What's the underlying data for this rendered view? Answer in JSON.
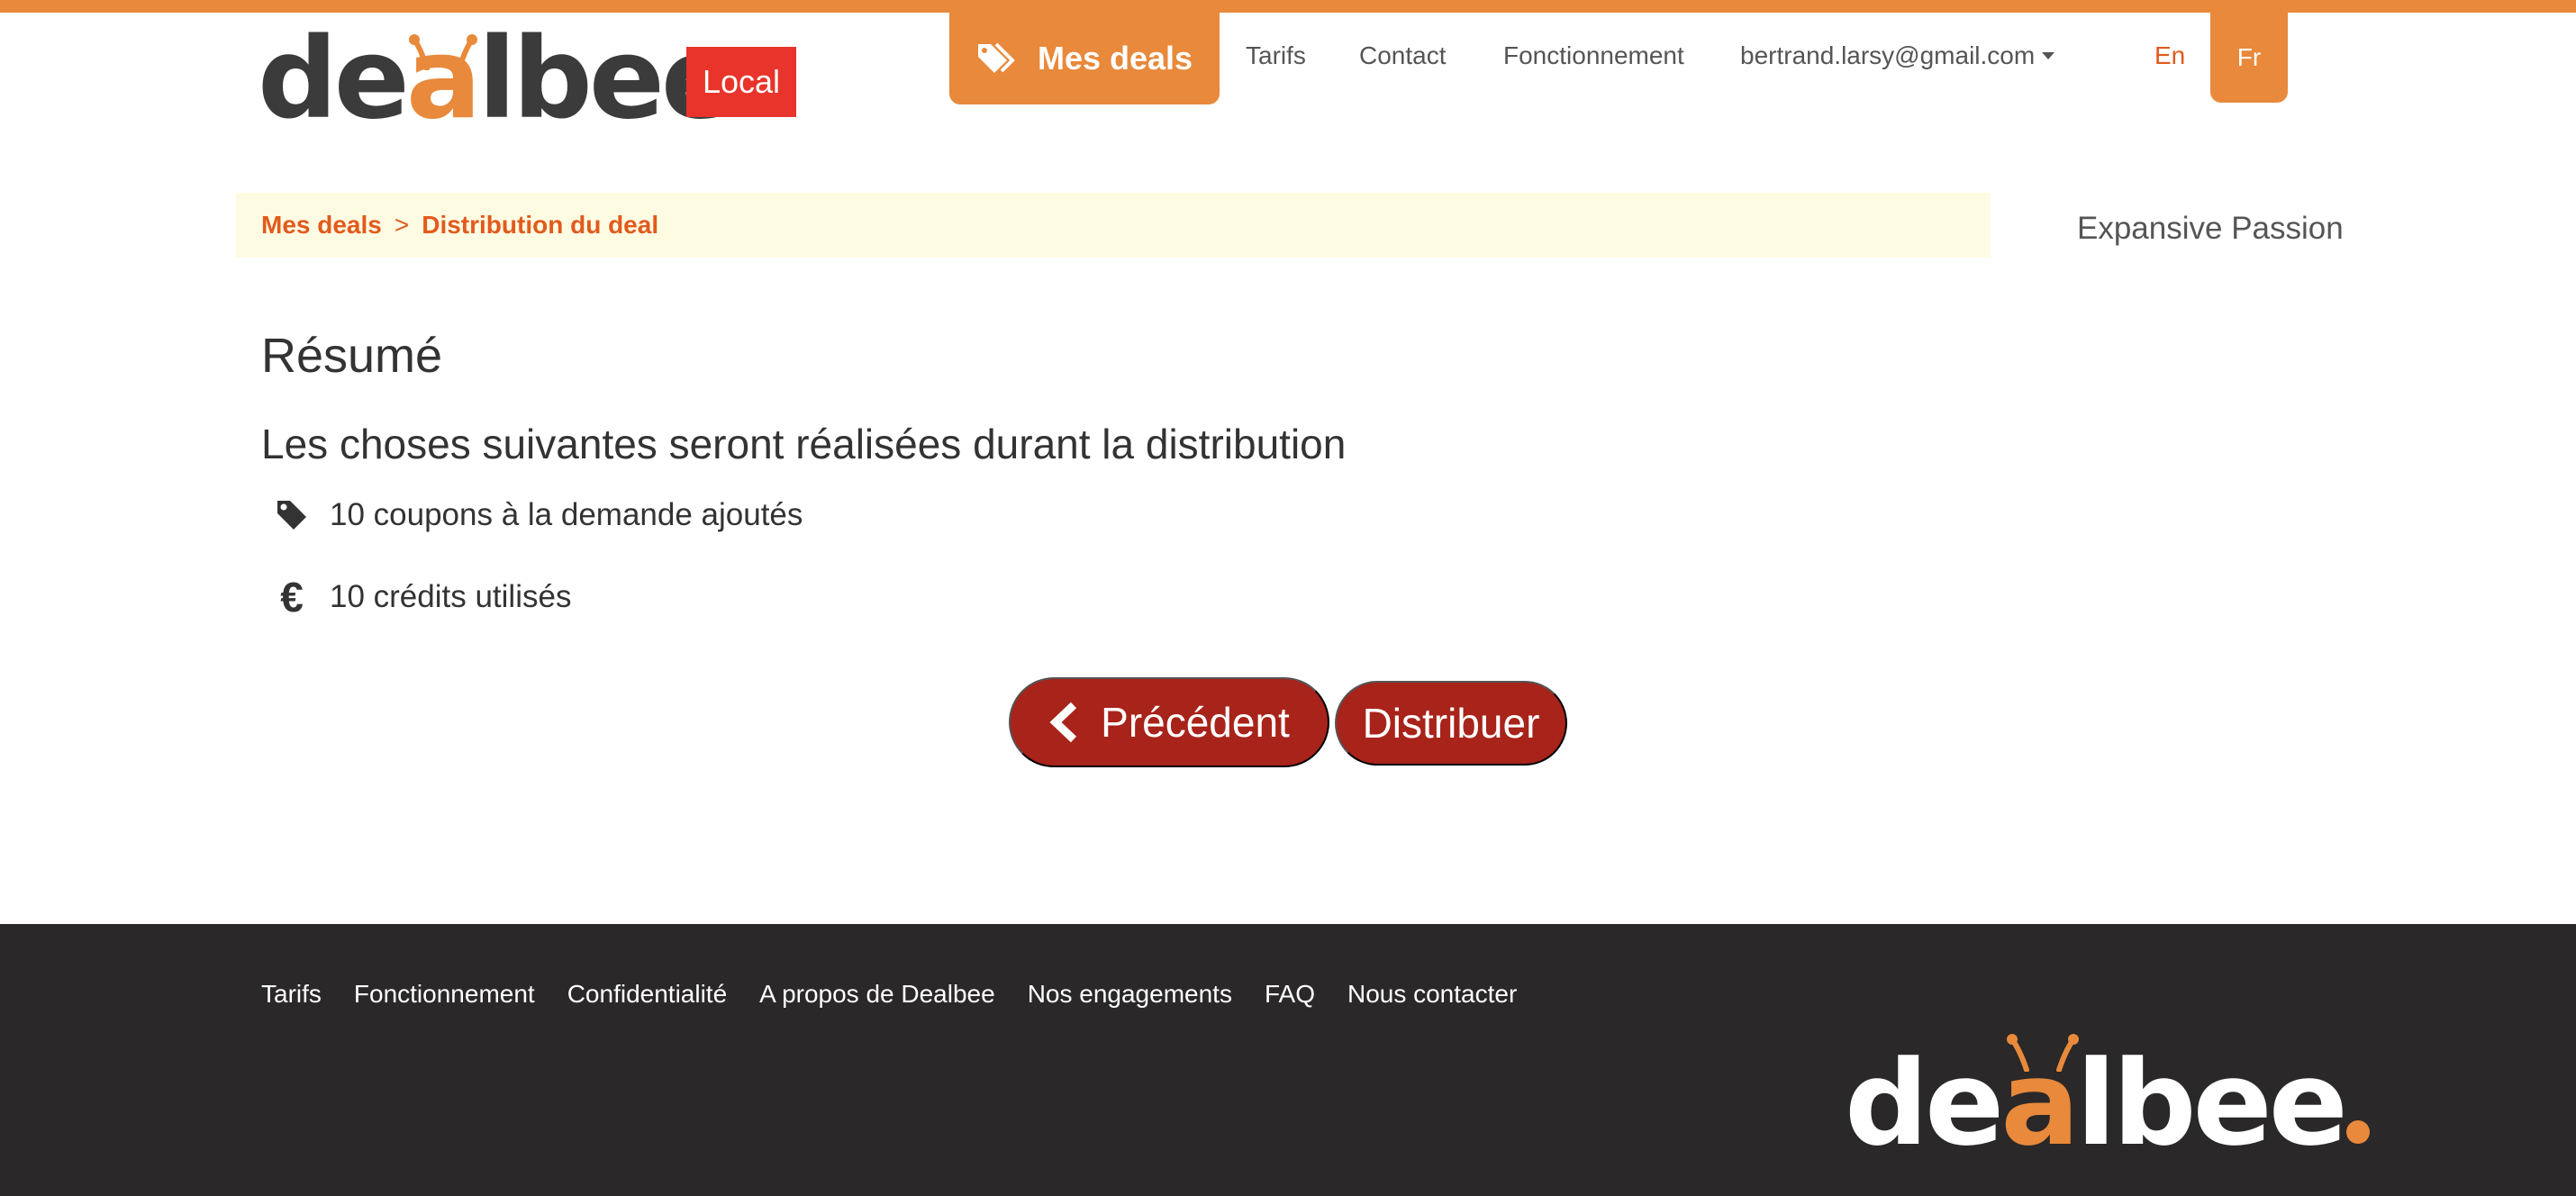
{
  "header": {
    "logo_prefix": "de",
    "logo_a": "a",
    "logo_suffix": "lbee",
    "badge": "Local",
    "nav": {
      "mes_deals": "Mes deals",
      "tarifs": "Tarifs",
      "contact": "Contact",
      "fonctionnement": "Fonctionnement",
      "user_email": "bertrand.larsy@gmail.com"
    },
    "lang": {
      "en": "En",
      "fr": "Fr"
    }
  },
  "breadcrumb": {
    "items": [
      "Mes deals",
      "Distribution du deal"
    ],
    "separator": ">"
  },
  "company_name": "Expansive Passion",
  "main": {
    "title": "Résumé",
    "subtitle": "Les choses suivantes seront réalisées durant la distribution",
    "items": [
      {
        "icon": "tag-icon",
        "text": "10 coupons à la demande ajoutés"
      },
      {
        "icon": "euro-icon",
        "text": "10 crédits utilisés"
      }
    ],
    "buttons": {
      "previous": "Précédent",
      "distribute": "Distribuer"
    }
  },
  "footer": {
    "links": [
      "Tarifs",
      "Fonctionnement",
      "Confidentialité",
      "A propos de Dealbee",
      "Nos engagements",
      "FAQ",
      "Nous contacter"
    ],
    "logo_prefix": "de",
    "logo_a": "a",
    "logo_suffix": "lbee"
  },
  "colors": {
    "brand_orange": "#e8893b",
    "link_orange": "#e25a1c",
    "badge_red": "#e8342a",
    "button_red": "#a8231a",
    "footer_bg": "#2a2829",
    "breadcrumb_bg": "#fefbe3"
  }
}
